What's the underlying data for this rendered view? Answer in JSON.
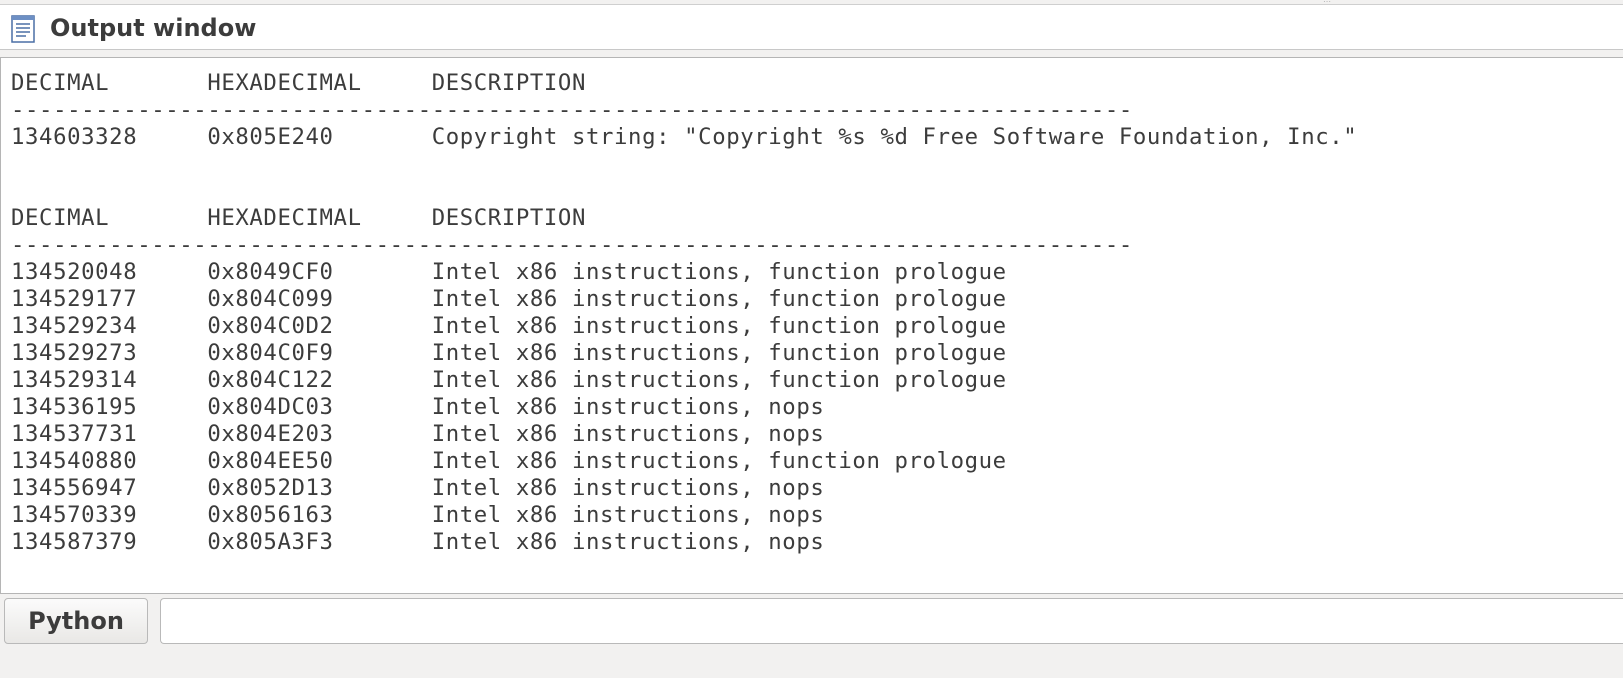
{
  "window": {
    "title": "Output window",
    "icon": "document-text-icon"
  },
  "output": {
    "lines": [
      "DECIMAL       HEXADECIMAL     DESCRIPTION",
      "--------------------------------------------------------------------------------",
      "134603328     0x805E240       Copyright string: \"Copyright %s %d Free Software Foundation, Inc.\"",
      "",
      "",
      "DECIMAL       HEXADECIMAL     DESCRIPTION",
      "--------------------------------------------------------------------------------",
      "134520048     0x8049CF0       Intel x86 instructions, function prologue",
      "134529177     0x804C099       Intel x86 instructions, function prologue",
      "134529234     0x804C0D2       Intel x86 instructions, function prologue",
      "134529273     0x804C0F9       Intel x86 instructions, function prologue",
      "134529314     0x804C122       Intel x86 instructions, function prologue",
      "134536195     0x804DC03       Intel x86 instructions, nops",
      "134537731     0x804E203       Intel x86 instructions, nops",
      "134540880     0x804EE50       Intel x86 instructions, function prologue",
      "134556947     0x8052D13       Intel x86 instructions, nops",
      "134570339     0x8056163       Intel x86 instructions, nops",
      "134587379     0x805A3F3       Intel x86 instructions, nops"
    ]
  },
  "console": {
    "language_button_label": "Python",
    "input_value": "",
    "input_placeholder": ""
  }
}
